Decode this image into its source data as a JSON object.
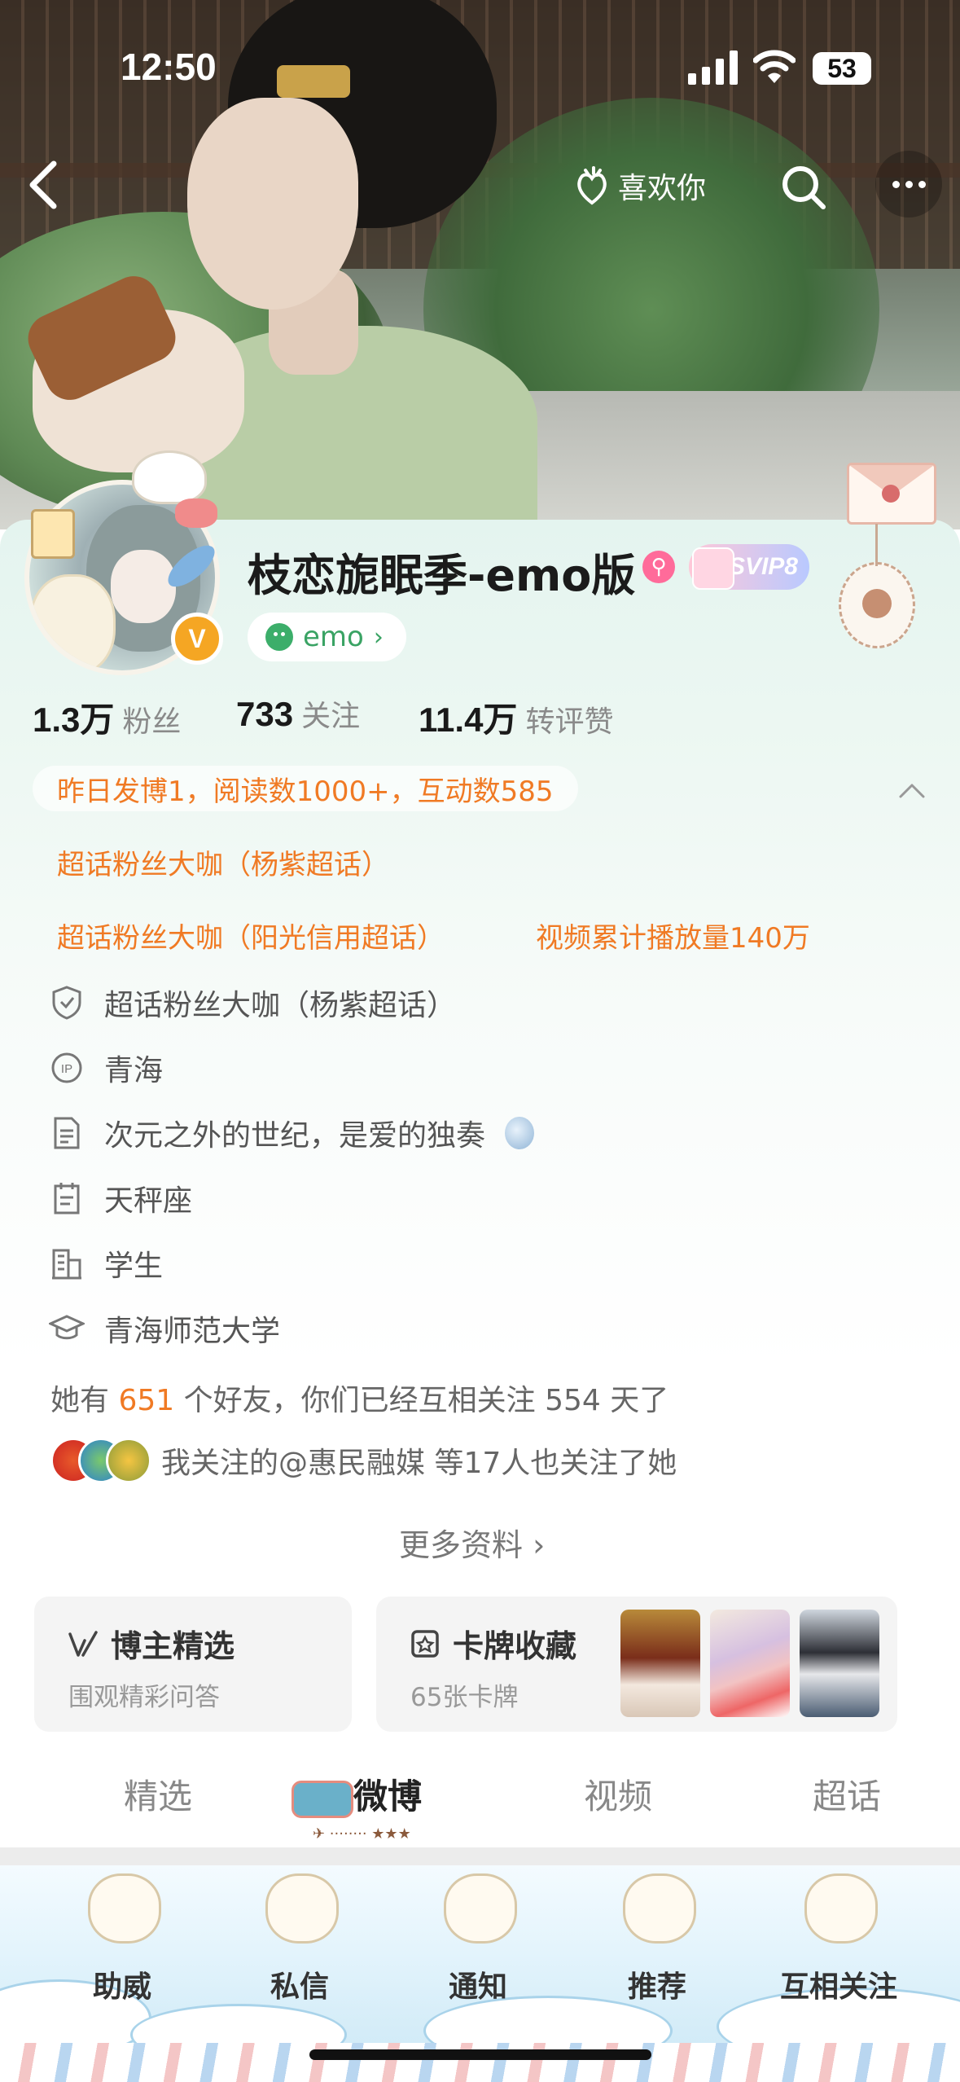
{
  "status_bar": {
    "time": "12:50",
    "battery": "53"
  },
  "nav": {
    "like_label": "喜欢你"
  },
  "profile": {
    "name": "枝恋旎眠季-emo版",
    "svip_label": "SVIP8",
    "verified_mark": "V",
    "mood": "emo"
  },
  "stats": {
    "fans_num": "1.3万",
    "fans_label": "粉丝",
    "follow_num": "733",
    "follow_label": "关注",
    "interact_num": "11.4万",
    "interact_label": "转评赞"
  },
  "highlights": [
    "昨日发博1，阅读数1000+，互动数585",
    "超话粉丝大咖（杨紫超话）",
    "超话粉丝大咖（阳光信用超话）",
    "视频累计播放量140万"
  ],
  "info": {
    "super_title": "超话粉丝大咖（杨紫超话）",
    "ip": "青海",
    "bio": "次元之外的世纪，是爱的独奏",
    "zodiac": "天秤座",
    "job": "学生",
    "school": "青海师范大学"
  },
  "friends": {
    "prefix": "她有",
    "count": "651",
    "suffix": "个好友，你们已经互相关注 554 天了"
  },
  "mutual": {
    "text": "我关注的@惠民融媒 等17人也关注了她"
  },
  "more_info": "更多资料 ›",
  "feature_cards": {
    "picks_title": "博主精选",
    "picks_sub": "围观精彩问答",
    "cards_title": "卡牌收藏",
    "cards_sub": "65张卡牌"
  },
  "tabs": {
    "picks": "精选",
    "weibo": "微博",
    "video": "视频",
    "super": "超话"
  },
  "bottom_bar": {
    "helper": "助威",
    "messages": "私信",
    "notify": "通知",
    "recommend": "推荐",
    "mutual": "互相关注"
  },
  "colors": {
    "accent_orange": "#f07a24",
    "mood_green": "#3aa364",
    "verified_gold": "#f5a623"
  }
}
